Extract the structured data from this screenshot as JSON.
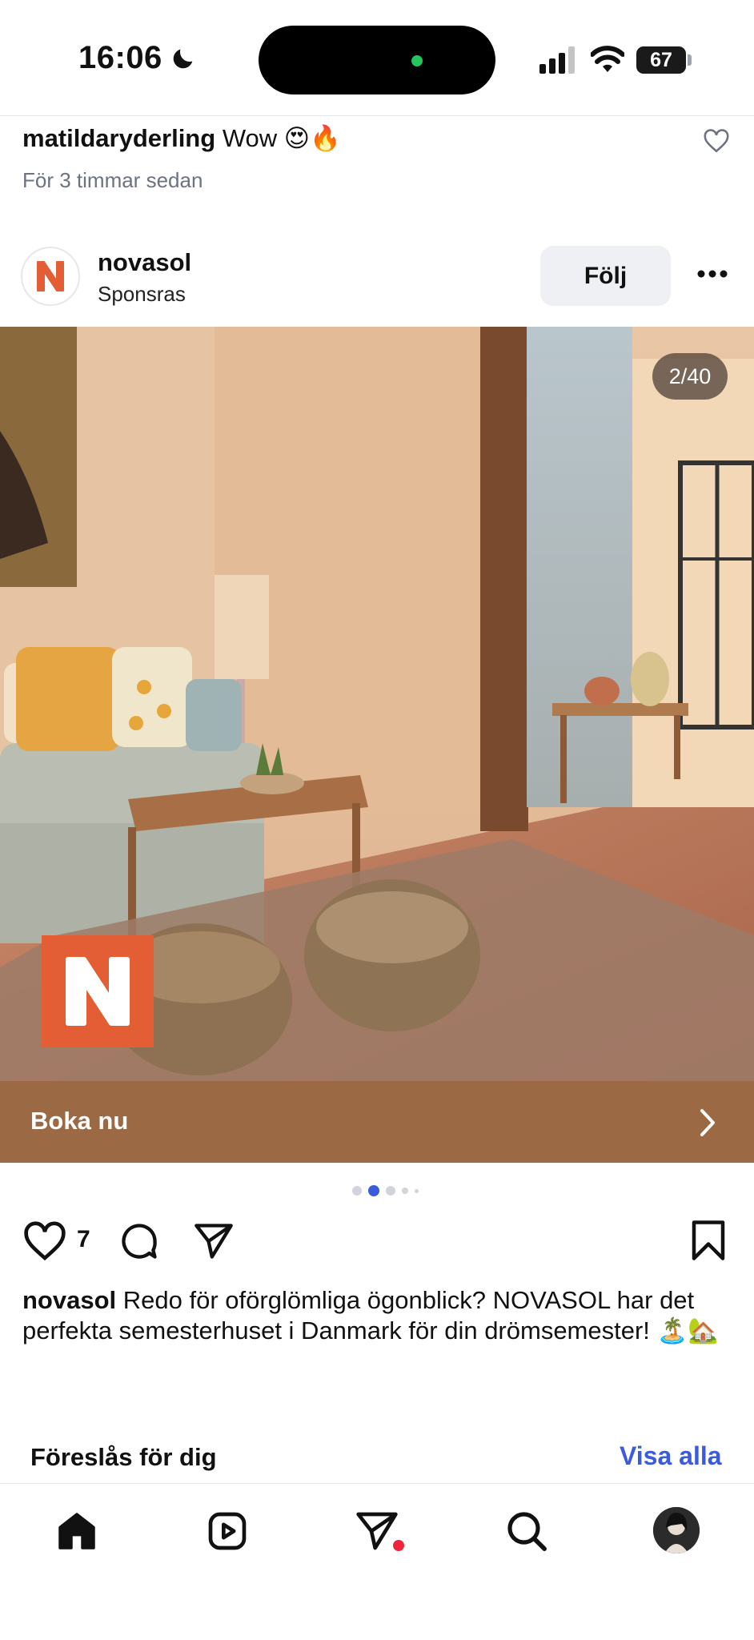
{
  "status_bar": {
    "time": "16:06",
    "battery": "67"
  },
  "comment": {
    "username": "matildaryderling",
    "text": "Wow 😍🔥",
    "time": "För 3 timmar sedan"
  },
  "post": {
    "brand": "novasol",
    "sponsored": "Sponsras",
    "follow_label": "Följ",
    "counter": "2/40",
    "logo_letter": "N",
    "cta_label": "Boka nu",
    "likes": "7",
    "caption_user": "novasol",
    "caption_text": "Redo för oförglömliga ögonblick? NOVASOL har det perfekta semesterhuset i Danmark för din drömsemester! 🏝️🏡"
  },
  "suggestions": {
    "title": "Föreslås för dig",
    "see_all": "Visa alla"
  },
  "colors": {
    "accent": "#3b5bdb",
    "cta": "#9b6a44",
    "brand": "#e35d35"
  },
  "icons": [
    "moon-icon",
    "signal-icon",
    "wifi-icon",
    "battery-icon",
    "heart-icon",
    "more-icon",
    "chevron-right-icon",
    "comment-icon",
    "share-icon",
    "bookmark-icon",
    "home-icon",
    "reels-icon",
    "messages-icon",
    "search-icon"
  ]
}
